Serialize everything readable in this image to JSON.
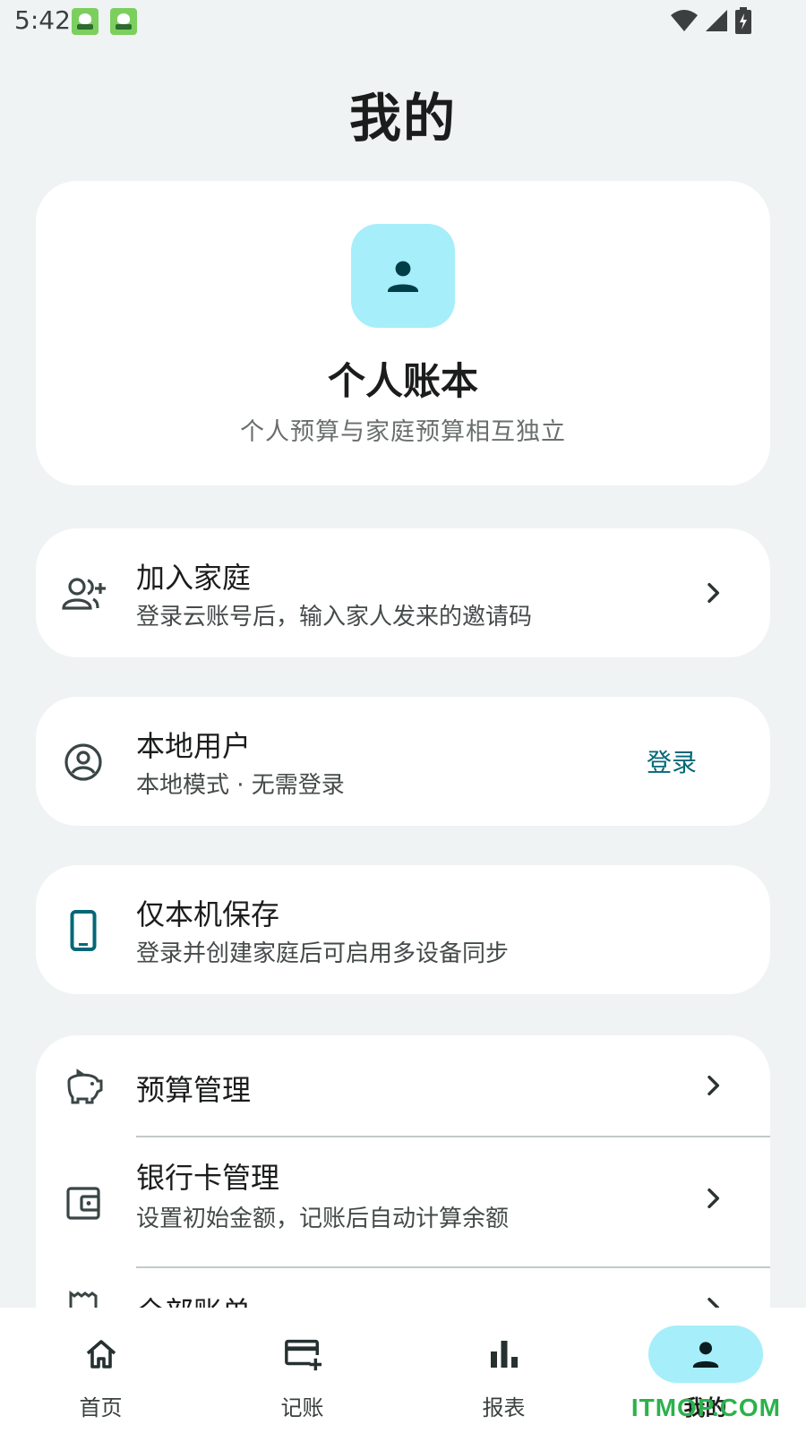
{
  "status": {
    "time": "5:42"
  },
  "page": {
    "title": "我的"
  },
  "profile": {
    "name": "个人账本",
    "subtitle": "个人预算与家庭预算相互独立",
    "accent": "#a6eefa"
  },
  "rows": {
    "join_family": {
      "title": "加入家庭",
      "subtitle": "登录云账号后，输入家人发来的邀请码",
      "icon": "person-add-icon"
    },
    "local_user": {
      "title": "本地用户",
      "subtitle": "本地模式 · 无需登录",
      "action": "登录",
      "icon": "account-circle-icon"
    },
    "local_only": {
      "title": "仅本机保存",
      "subtitle": "登录并创建家庭后可启用多设备同步",
      "icon": "smartphone-icon"
    }
  },
  "settings": {
    "budget": {
      "title": "预算管理",
      "icon": "piggy-bank-icon"
    },
    "bank_card": {
      "title": "银行卡管理",
      "subtitle": "设置初始金额，记账后自动计算余额",
      "icon": "wallet-icon"
    },
    "all_bills": {
      "title": "全部账单",
      "icon": "receipt-icon"
    }
  },
  "nav": [
    {
      "label": "首页",
      "icon": "home-icon"
    },
    {
      "label": "记账",
      "icon": "card-add-icon"
    },
    {
      "label": "报表",
      "icon": "bar-chart-icon"
    },
    {
      "label": "我的",
      "icon": "person-icon",
      "active": true
    }
  ],
  "watermark": "ITMOP.COM",
  "colors": {
    "background": "#eff3f3",
    "accent": "#006877",
    "pill": "#a6eefa"
  }
}
